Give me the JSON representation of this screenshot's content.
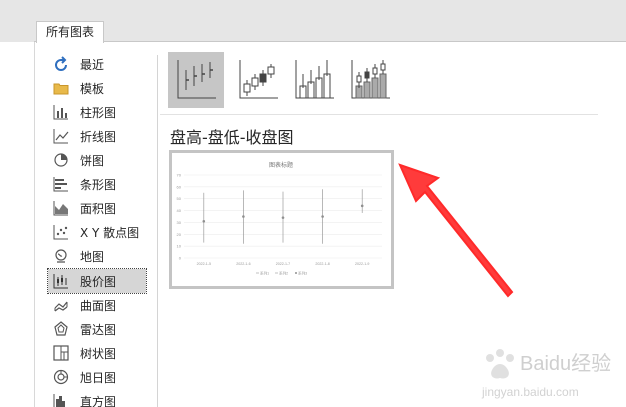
{
  "tab": {
    "label": "所有图表"
  },
  "sidebar": {
    "items": [
      {
        "label": "最近",
        "icon": "recent-icon"
      },
      {
        "label": "模板",
        "icon": "folder-icon"
      },
      {
        "label": "柱形图",
        "icon": "column-chart-icon"
      },
      {
        "label": "折线图",
        "icon": "line-chart-icon"
      },
      {
        "label": "饼图",
        "icon": "pie-chart-icon"
      },
      {
        "label": "条形图",
        "icon": "bar-chart-icon"
      },
      {
        "label": "面积图",
        "icon": "area-chart-icon"
      },
      {
        "label": "X Y 散点图",
        "icon": "scatter-chart-icon"
      },
      {
        "label": "地图",
        "icon": "map-chart-icon"
      },
      {
        "label": "股价图",
        "icon": "stock-chart-icon",
        "selected": true
      },
      {
        "label": "曲面图",
        "icon": "surface-chart-icon"
      },
      {
        "label": "雷达图",
        "icon": "radar-chart-icon"
      },
      {
        "label": "树状图",
        "icon": "treemap-chart-icon"
      },
      {
        "label": "旭日图",
        "icon": "sunburst-chart-icon"
      },
      {
        "label": "直方图",
        "icon": "histogram-chart-icon"
      }
    ]
  },
  "subtypes": [
    {
      "name": "high-low-close",
      "selected": true
    },
    {
      "name": "open-high-low-close"
    },
    {
      "name": "volume-high-low-close"
    },
    {
      "name": "volume-open-high-low-close"
    }
  ],
  "chart_heading": "盘高-盘低-收盘图",
  "preview": {
    "title": "图表标题",
    "y_ticks": [
      "70",
      "60",
      "50",
      "40",
      "30",
      "20",
      "10",
      "0"
    ],
    "x_labels": [
      "2022-1-5",
      "2022-1-6",
      "2022-1-7",
      "2022-1-8",
      "2022-1-9"
    ],
    "legend": [
      "系列1",
      "系列2",
      "系列3"
    ]
  },
  "chart_data": {
    "type": "stock",
    "title": "图表标题",
    "categories": [
      "2022-1-5",
      "2022-1-6",
      "2022-1-7",
      "2022-1-8",
      "2022-1-9"
    ],
    "series": [
      {
        "name": "系列1",
        "values": [
          55,
          57,
          56,
          58,
          58
        ]
      },
      {
        "name": "系列2",
        "values": [
          13,
          12,
          13,
          12,
          38
        ]
      },
      {
        "name": "系列3",
        "values": [
          31,
          35,
          34,
          35,
          44
        ]
      }
    ],
    "ylim": [
      0,
      70
    ],
    "grid": true,
    "legend_position": "bottom"
  },
  "watermark": {
    "text1": "Baidu经验",
    "text2": "jingyan.baidu.com"
  },
  "colors": {
    "accent": "#ff3333",
    "selected_bg": "#d6d6d6",
    "subtype_selected_bg": "#c6c6c6"
  }
}
